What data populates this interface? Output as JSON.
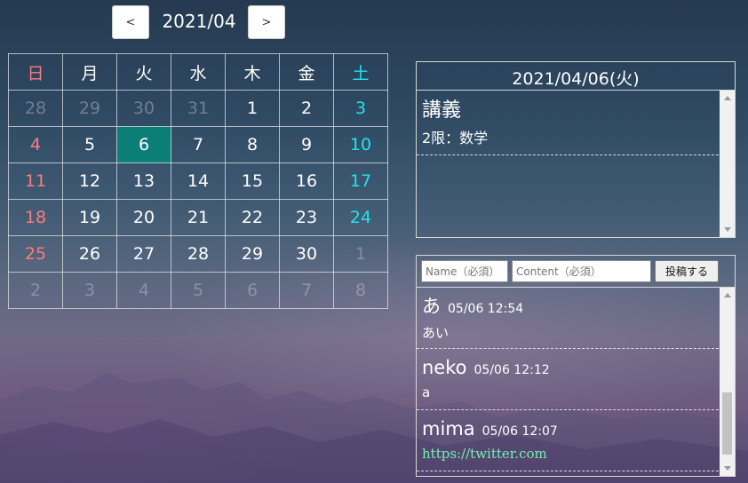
{
  "nav": {
    "prev_label": "<",
    "next_label": ">",
    "month": "2021/04"
  },
  "calendar": {
    "weekdays": [
      "日",
      "月",
      "火",
      "水",
      "木",
      "金",
      "土"
    ],
    "weeks": [
      [
        "28",
        "29",
        "30",
        "31",
        "1",
        "2",
        "3"
      ],
      [
        "4",
        "5",
        "6",
        "7",
        "8",
        "9",
        "10"
      ],
      [
        "11",
        "12",
        "13",
        "14",
        "15",
        "16",
        "17"
      ],
      [
        "18",
        "19",
        "20",
        "21",
        "22",
        "23",
        "24"
      ],
      [
        "25",
        "26",
        "27",
        "28",
        "29",
        "30",
        "1"
      ],
      [
        "2",
        "3",
        "4",
        "5",
        "6",
        "7",
        "8"
      ]
    ],
    "selected": "6"
  },
  "detail": {
    "date": "2021/04/06(火)",
    "events": [
      {
        "title": "講義",
        "sub": "2限：数学"
      }
    ]
  },
  "chat": {
    "name_placeholder": "Name（必須）",
    "content_placeholder": "Content（必須）",
    "post_label": "投稿する",
    "messages": [
      {
        "name": "あ",
        "time": "05/06 12:54",
        "body": "あい"
      },
      {
        "name": "neko",
        "time": "05/06 12:12",
        "body": "a"
      },
      {
        "name": "mima",
        "time": "05/06 12:07",
        "body": "https://twitter.com"
      }
    ]
  },
  "colors": {
    "sunday": "#ff7b7b",
    "saturday": "#1fe5ec",
    "selected_bg": "#0b7f76",
    "link": "#73f0b5"
  }
}
